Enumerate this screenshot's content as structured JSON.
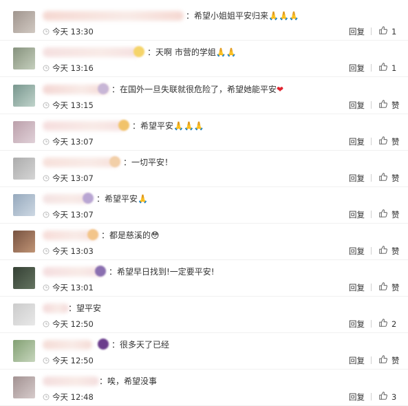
{
  "comments": [
    {
      "text": "：希望小姐姐平安归来",
      "emoji": "🙏🙏🙏",
      "time": "今天 13:30",
      "reply": "回复",
      "like": "1"
    },
    {
      "text": "：天啊 市营的学姐",
      "emoji": "🙏🙏",
      "time": "今天 13:16",
      "reply": "回复",
      "like": "1"
    },
    {
      "text": "：在国外一旦失联就很危险了，希望她能平安",
      "emoji": "❤",
      "time": "今天 13:15",
      "reply": "回复",
      "like": "赞"
    },
    {
      "text": "：希望平安",
      "emoji": "🙏🙏🙏",
      "time": "今天 13:07",
      "reply": "回复",
      "like": "赞"
    },
    {
      "text": "：一切平安！",
      "emoji": "",
      "time": "今天 13:07",
      "reply": "回复",
      "like": "赞"
    },
    {
      "text": "：希望平安",
      "emoji": "🙏",
      "time": "今天 13:07",
      "reply": "回复",
      "like": "赞"
    },
    {
      "text": "：都是慈溪的",
      "emoji": "😳",
      "time": "今天 13:03",
      "reply": "回复",
      "like": "赞"
    },
    {
      "text": "：希望早日找到!一定要平安!",
      "emoji": "",
      "time": "今天 13:01",
      "reply": "回复",
      "like": "赞"
    },
    {
      "text": "：望平安",
      "emoji": "",
      "time": "今天 12:50",
      "reply": "回复",
      "like": "2"
    },
    {
      "text": "：很多天了已经",
      "emoji": "",
      "time": "今天 12:50",
      "reply": "回复",
      "like": "赞"
    },
    {
      "text": "：唉，希望没事",
      "emoji": "",
      "time": "今天 12:48",
      "reply": "回复",
      "like": "3"
    }
  ]
}
